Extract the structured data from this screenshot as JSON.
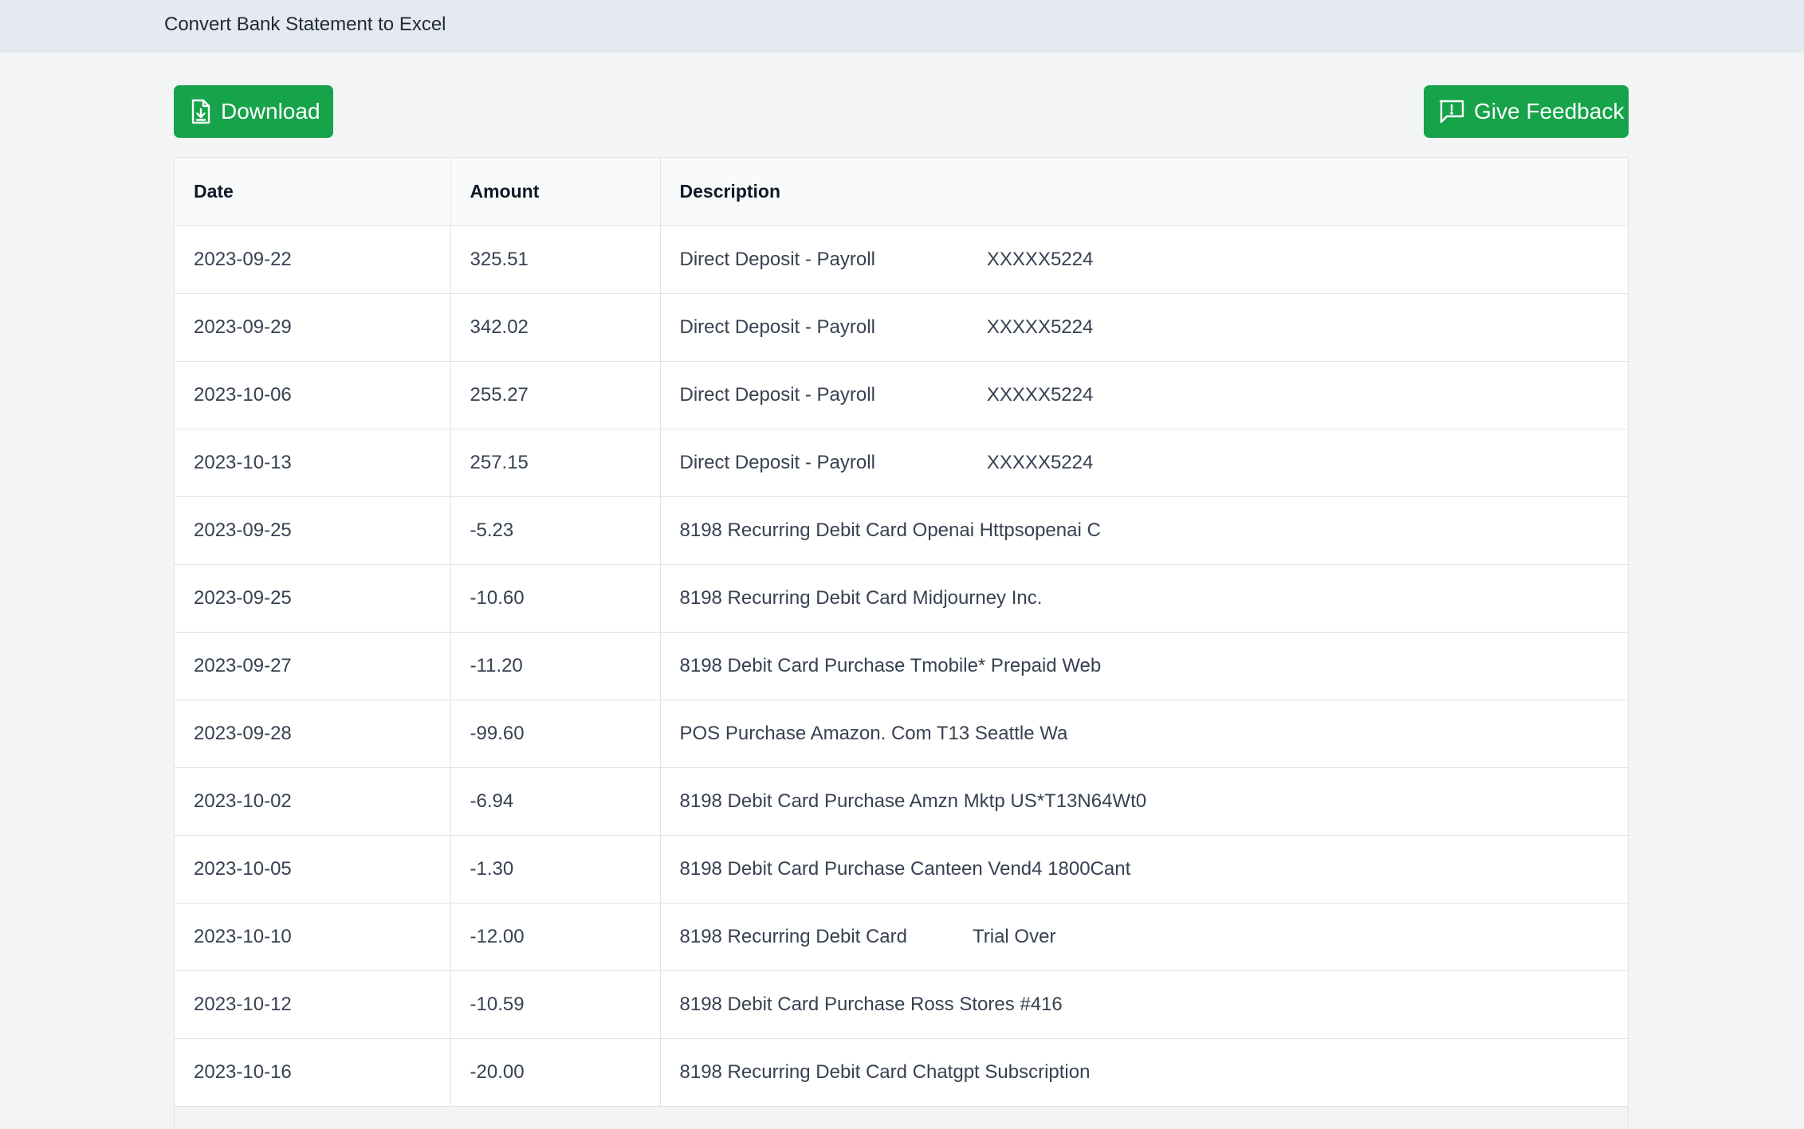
{
  "header": {
    "title": "Convert Bank Statement to Excel"
  },
  "toolbar": {
    "download_label": "Download",
    "download_icon": "file-download-icon",
    "feedback_label": "Give Feedback",
    "feedback_icon": "feedback-alert-icon",
    "accent_color": "#16a34a"
  },
  "table": {
    "columns": [
      "Date",
      "Amount",
      "Description"
    ],
    "rows": [
      {
        "date": "2023-09-22",
        "amount": "325.51",
        "description": "Direct Deposit - Payroll",
        "description_extra": "XXXXX5224"
      },
      {
        "date": "2023-09-29",
        "amount": "342.02",
        "description": "Direct Deposit - Payroll",
        "description_extra": "XXXXX5224"
      },
      {
        "date": "2023-10-06",
        "amount": "255.27",
        "description": "Direct Deposit - Payroll",
        "description_extra": "XXXXX5224"
      },
      {
        "date": "2023-10-13",
        "amount": "257.15",
        "description": "Direct Deposit - Payroll",
        "description_extra": "XXXXX5224"
      },
      {
        "date": "2023-09-25",
        "amount": "-5.23",
        "description": "8198 Recurring Debit Card Openai Httpsopenai C",
        "description_extra": ""
      },
      {
        "date": "2023-09-25",
        "amount": "-10.60",
        "description": "8198 Recurring Debit Card Midjourney Inc.",
        "description_extra": ""
      },
      {
        "date": "2023-09-27",
        "amount": "-11.20",
        "description": "8198 Debit Card Purchase Tmobile* Prepaid Web",
        "description_extra": ""
      },
      {
        "date": "2023-09-28",
        "amount": "-99.60",
        "description": "POS Purchase Amazon. Com T13 Seattle Wa",
        "description_extra": ""
      },
      {
        "date": "2023-10-02",
        "amount": "-6.94",
        "description": "8198 Debit Card Purchase Amzn Mktp US*T13N64Wt0",
        "description_extra": ""
      },
      {
        "date": "2023-10-05",
        "amount": "-1.30",
        "description": "8198 Debit Card Purchase Canteen Vend4 1800Cant",
        "description_extra": ""
      },
      {
        "date": "2023-10-10",
        "amount": "-12.00",
        "description": "8198 Recurring Debit Card",
        "description_extra": "Trial Over"
      },
      {
        "date": "2023-10-12",
        "amount": "-10.59",
        "description": "8198 Debit Card Purchase Ross Stores #416",
        "description_extra": ""
      },
      {
        "date": "2023-10-16",
        "amount": "-20.00",
        "description": "8198 Recurring Debit Card Chatgpt Subscription",
        "description_extra": ""
      }
    ]
  }
}
